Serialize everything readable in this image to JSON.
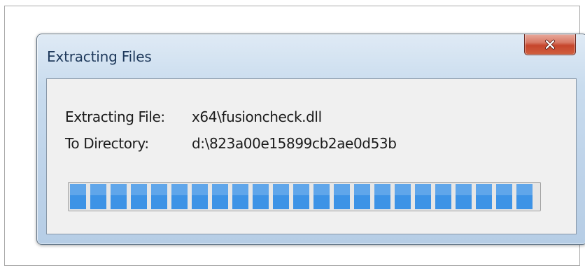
{
  "dialog": {
    "title": "Extracting Files",
    "close_label": "x"
  },
  "fields": {
    "file_label": "Extracting File:",
    "file_value": "x64\\fusioncheck.dll",
    "dir_label": "To Directory:",
    "dir_value": "d:\\823a00e15899cb2ae0d53b"
  },
  "progress": {
    "fraction": 0.995
  },
  "colors": {
    "progress_segment": "#3d93e6",
    "close_button": "#c6452c",
    "title_text": "#1e395b"
  },
  "icons": {
    "close": "close-icon"
  }
}
